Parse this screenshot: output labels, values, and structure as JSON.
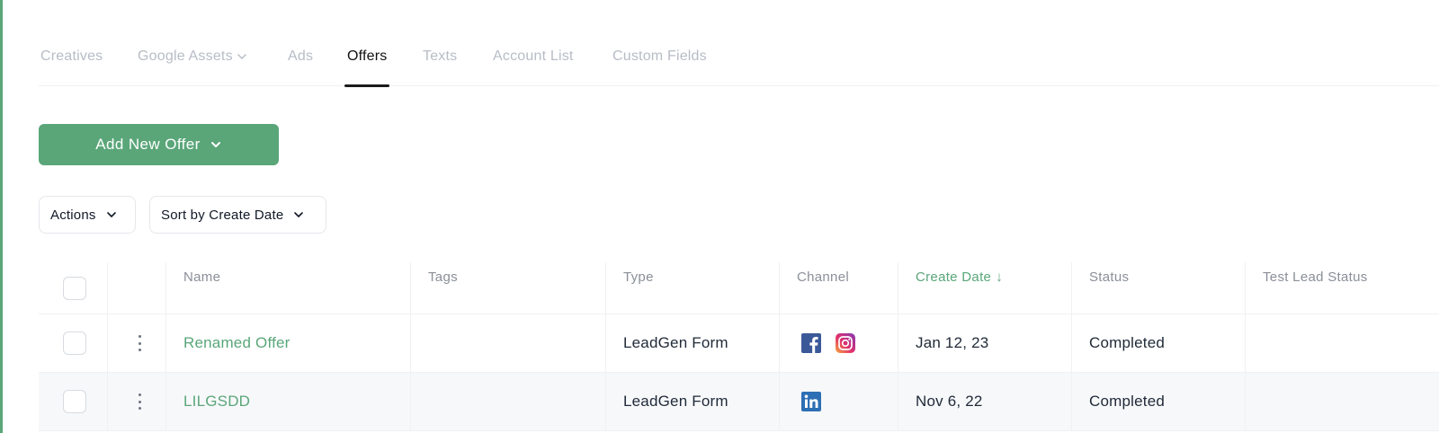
{
  "tabs": [
    {
      "label": "Creatives",
      "active": false
    },
    {
      "label": "Google Assets",
      "active": false,
      "has_dropdown": true
    },
    {
      "label": "Ads",
      "active": false
    },
    {
      "label": "Offers",
      "active": true
    },
    {
      "label": "Texts",
      "active": false
    },
    {
      "label": "Account List",
      "active": false
    },
    {
      "label": "Custom Fields",
      "active": false
    }
  ],
  "add_button": {
    "label": "Add New Offer"
  },
  "filters": {
    "actions_label": "Actions",
    "sort_label": "Sort by Create Date"
  },
  "table": {
    "columns": {
      "name": "Name",
      "tags": "Tags",
      "type": "Type",
      "channel": "Channel",
      "create_date": "Create Date",
      "create_date_sort_icon": "↓",
      "status": "Status",
      "test_lead_status": "Test Lead Status"
    },
    "rows": [
      {
        "name": "Renamed Offer",
        "tags": "",
        "type": "LeadGen Form",
        "channels": [
          "facebook-icon",
          "instagram-icon"
        ],
        "create_date": "Jan 12, 23",
        "status": "Completed",
        "test_lead_status": ""
      },
      {
        "name": "LILGSDD",
        "tags": "",
        "type": "LeadGen Form",
        "channels": [
          "linkedin-icon"
        ],
        "create_date": "Nov 6, 22",
        "status": "Completed",
        "test_lead_status": ""
      }
    ]
  },
  "colors": {
    "accent": "#5aa679",
    "facebook": "#3b5998",
    "linkedin": "#2d6fb4",
    "instagram": "#c13584"
  }
}
